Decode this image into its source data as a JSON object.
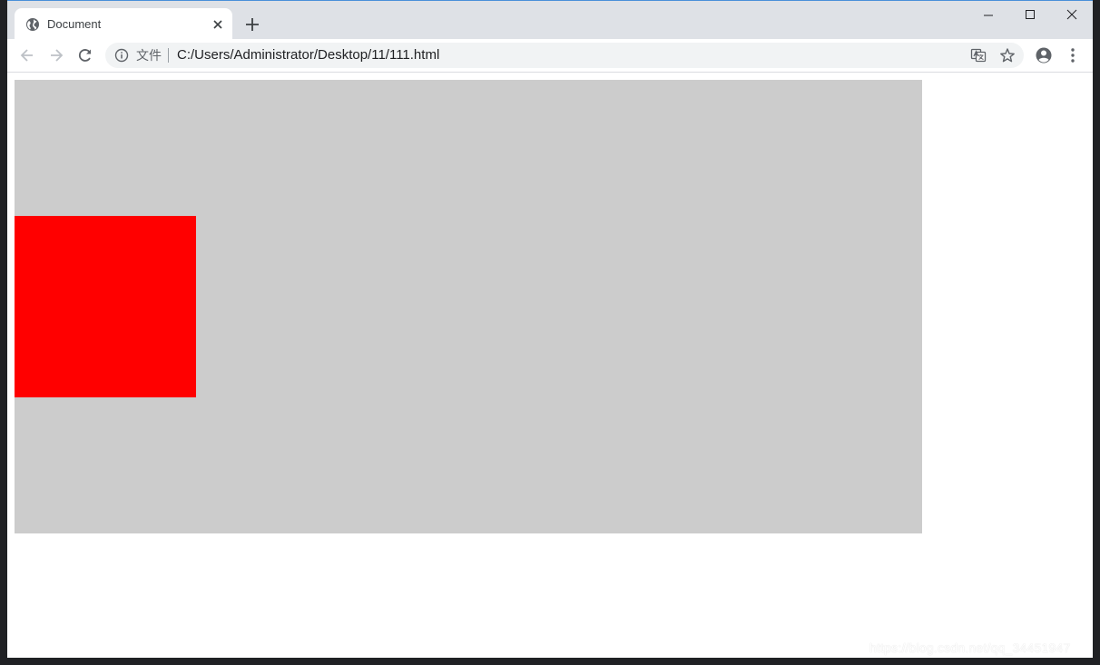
{
  "tab": {
    "title": "Document",
    "favicon": "globe-icon",
    "close": "close-icon"
  },
  "new_tab": "plus-icon",
  "window_controls": [
    "minimize-icon",
    "maximize-icon",
    "close-icon"
  ],
  "toolbar": {
    "back": "arrow-left-icon",
    "forward": "arrow-right-icon",
    "reload": "reload-icon"
  },
  "omnibox": {
    "scheme_label": "文件",
    "url": "C:/Users/Administrator/Desktop/11/111.html",
    "site_info": "info-icon",
    "translate": "translate-icon",
    "bookmark": "star-icon"
  },
  "profile": "account-circle-icon",
  "menu": "more-vert-icon",
  "page": {
    "container_color": "#cccccc",
    "box_color": "#ff0000"
  },
  "watermark": "https://blog.csdn.net/qq_34451947"
}
